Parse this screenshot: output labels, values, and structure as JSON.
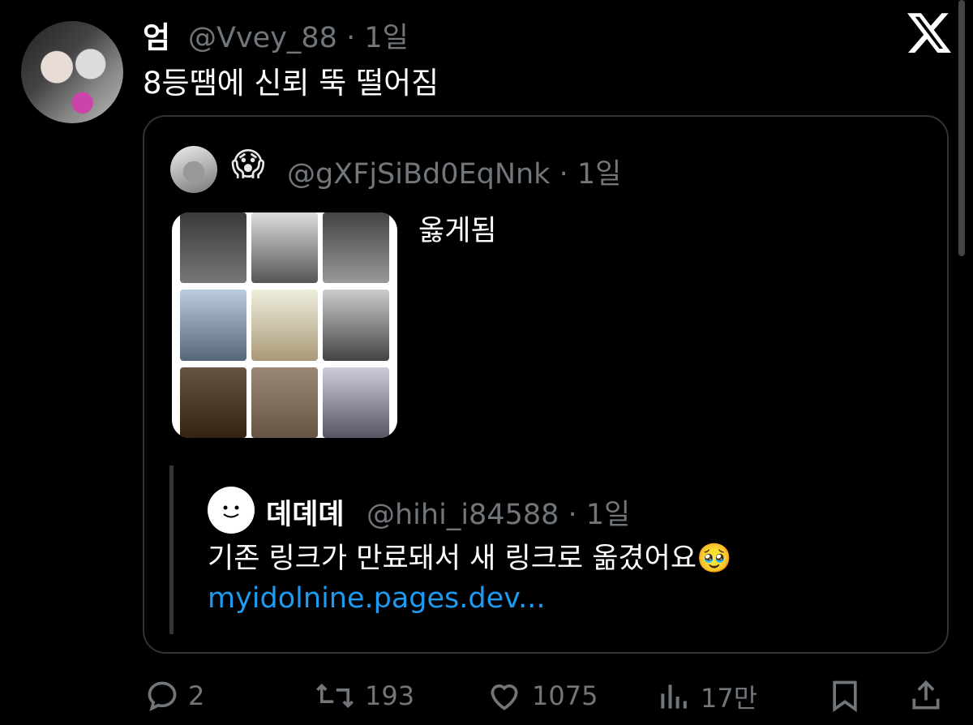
{
  "tweet": {
    "author_name": "엄",
    "author_handle_time": "@Vvey_88 · 1일",
    "text": "8등땜에 신뢰 뚝 떨어짐"
  },
  "quoted": {
    "emoji": "😱",
    "handle_time": "@gXFjSiBd0EqNnk · 1일",
    "text": "옳게됨",
    "nested": {
      "name": "뎨뎨뎨",
      "handle_time": "@hihi_i84588 · 1일",
      "text": "기존 링크가 만료돼서 새 링크로 옮겼어요🥹",
      "link": "myidolnine.pages.dev..."
    }
  },
  "actions": {
    "replies": "2",
    "retweets": "193",
    "likes": "1075",
    "views": "17만"
  },
  "icons": [
    "x-logo-icon",
    "reply-icon",
    "retweet-icon",
    "like-icon",
    "views-icon",
    "bookmark-icon",
    "share-icon"
  ],
  "colors": {
    "background": "#000000",
    "text": "#e7e9ea",
    "muted": "#71767b",
    "link": "#1d9bf0",
    "border": "#2f3336"
  }
}
